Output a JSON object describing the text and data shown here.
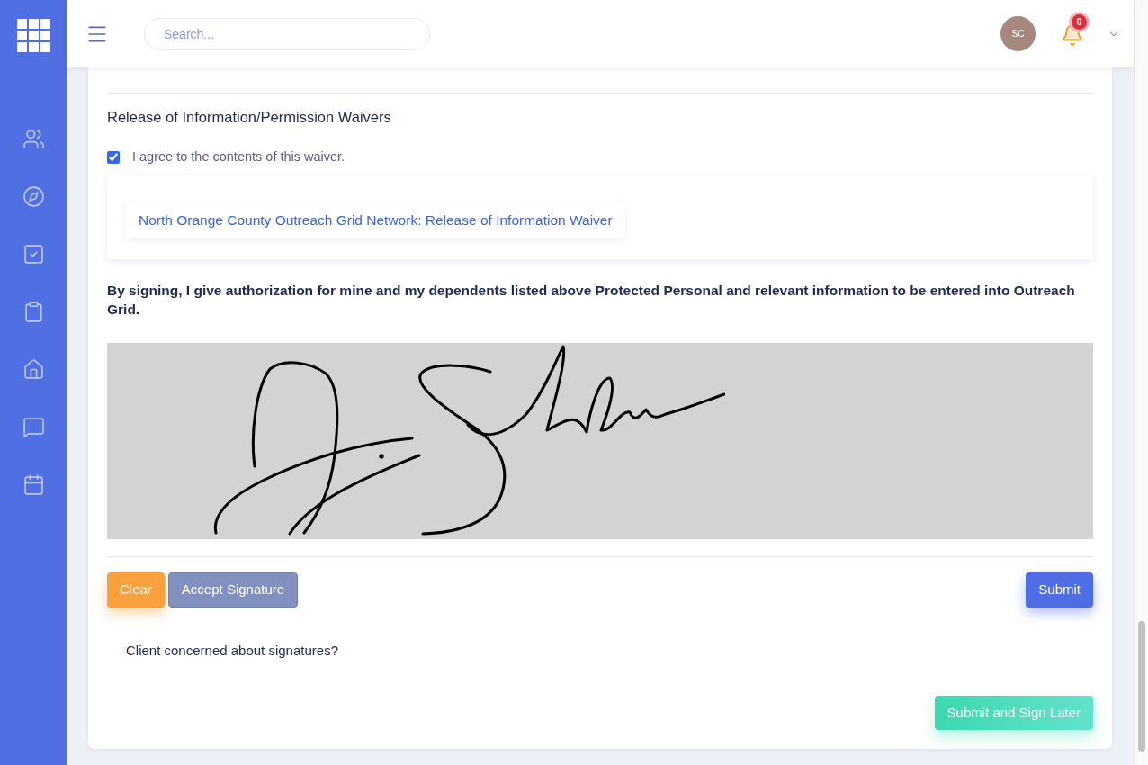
{
  "header": {
    "search": {
      "placeholder": "Search..."
    },
    "user": {
      "initials": "SC"
    },
    "notifications": {
      "count": "0"
    }
  },
  "waiver": {
    "title": "Release of Information/Permission Waivers",
    "agree": {
      "label": "I agree to the contents of this waiver.",
      "checked": true
    },
    "documents": [
      {
        "label": "North Orange County Outreach Grid Network: Release of Information Waiver"
      }
    ],
    "authorization": "By signing, I give authorization for mine and my dependents listed above Protected Personal and relevant information to be entered into Outreach Grid."
  },
  "signature_buttons": [
    {
      "label": "Clear",
      "kind": "warning"
    },
    {
      "label": "Accept Signature",
      "kind": "secondary"
    }
  ],
  "submit_button": {
    "label": "Submit",
    "kind": "primary"
  },
  "sign_later": {
    "question": "Client concerned about signatures?",
    "button": {
      "label": "Submit and Sign Later",
      "kind": "success"
    }
  }
}
